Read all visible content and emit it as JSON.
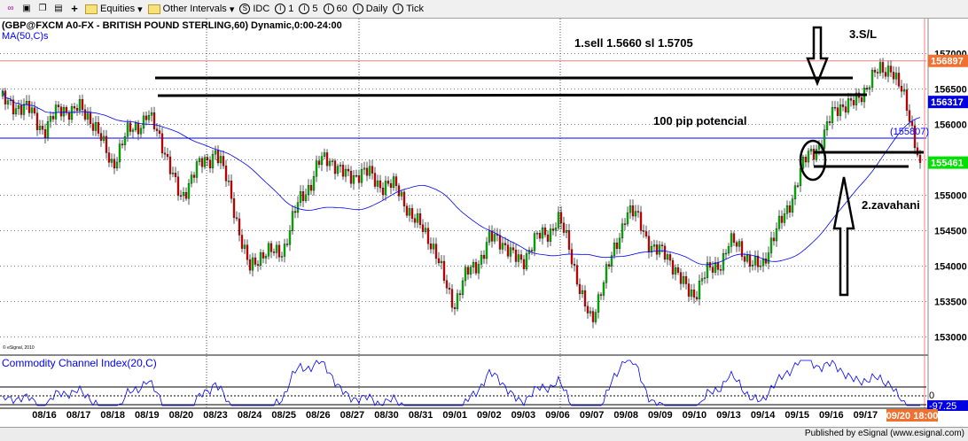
{
  "toolbar": {
    "items": [
      {
        "icon": "link-icon"
      },
      {
        "icon": "refresh-icon"
      },
      {
        "icon": "copy-icon"
      },
      {
        "icon": "properties-icon"
      },
      {
        "icon": "plus-icon"
      }
    ],
    "equities": "Equities",
    "other_intervals": "Other Intervals",
    "intervals": [
      {
        "icon": "S",
        "label": "IDC"
      },
      {
        "icon": "I",
        "label": "1"
      },
      {
        "icon": "I",
        "label": "5"
      },
      {
        "icon": "I",
        "label": "60"
      },
      {
        "icon": "I",
        "label": "Daily"
      },
      {
        "icon": "I",
        "label": "Tick"
      }
    ]
  },
  "chart_data": {
    "type": "candlestick",
    "title": "(GBP@FXCM A0-FX - BRITISH POUND STERLING,60) Dynamic,0:00-24:00",
    "indicator": "MA(50,C)s",
    "copyright": "© eSignal, 2010",
    "x_tick_labels": [
      "08/16",
      "08/17",
      "08/18",
      "08/19",
      "08/20",
      "08/23",
      "08/24",
      "08/25",
      "08/26",
      "08/27",
      "08/30",
      "08/31",
      "09/01",
      "09/02",
      "09/03",
      "09/06",
      "09/07",
      "09/08",
      "09/09",
      "09/10",
      "09/13",
      "09/14",
      "09/15",
      "09/16",
      "09/17"
    ],
    "current_time_label": "09/20 18:00",
    "y_tick_labels": [
      "157000",
      "156500",
      "156000",
      "155500",
      "155000",
      "154500",
      "154000",
      "153500",
      "153000"
    ],
    "ylim": [
      152700,
      157400
    ],
    "approx_closes": [
      156400,
      156000,
      156300,
      155500,
      156200,
      155000,
      155700,
      154000,
      154300,
      155500,
      155300,
      155200,
      154600,
      153500,
      154400,
      154100,
      154700,
      153200,
      154800,
      154200,
      153600,
      154300,
      154000,
      155200,
      156100,
      156500,
      156900,
      155461
    ],
    "price_tags": {
      "high": "156897",
      "ma": "156317",
      "last": "155461",
      "marker": "(155807)"
    },
    "colors": {
      "up": "#00c000",
      "down": "#e00000",
      "ma": "#0000ff",
      "high_tag": "#f07030",
      "ma_tag": "#0000e0",
      "last_tag": "#00e000"
    },
    "cci": {
      "label": "Commodity Channel Index(20,C)",
      "zero_label": "0",
      "value": "-97.25"
    },
    "annotations": {
      "sell": "1.sell 1.5660 sl 1.5705",
      "pip": "100 pip potencial",
      "sl": "3.S/L",
      "entry": "2.zavahani"
    }
  },
  "status": "Published by eSignal (www.esignal.com)"
}
